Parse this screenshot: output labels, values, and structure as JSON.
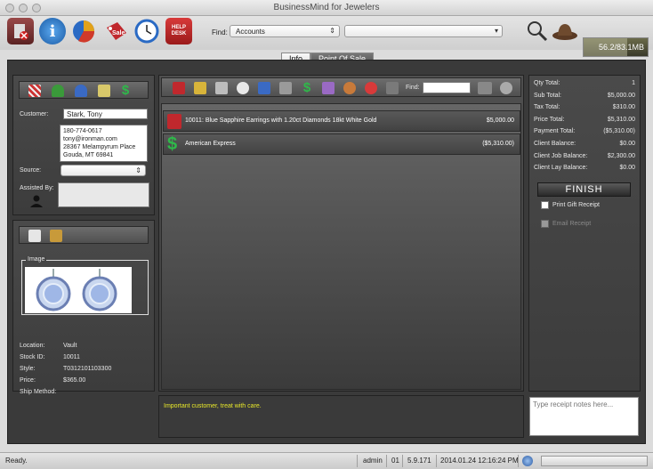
{
  "window": {
    "title": "BusinessMind for Jewelers"
  },
  "toolbar": {
    "buttons": [
      {
        "name": "close-document-icon",
        "color": "#8a3a3a",
        "label": ""
      },
      {
        "name": "info-icon",
        "color": "#1f6fc4",
        "label": ""
      },
      {
        "name": "pie-chart-icon",
        "color": "#d08a20",
        "label": ""
      },
      {
        "name": "sale-tag-icon",
        "color": "#c0282d",
        "label": "Sale"
      },
      {
        "name": "clock-icon",
        "color": "#3a7ac0",
        "label": ""
      },
      {
        "name": "help-desk-icon",
        "color": "#c0282d",
        "label": "HELP DESK"
      }
    ],
    "find_label": "Find:",
    "find_category": "Accounts",
    "find_value": "",
    "search_icon": "magnifier-icon",
    "hat_icon": "detective-hat-icon",
    "memory": "56.2/83.1MB",
    "memory_fraction": 0.68
  },
  "tabs": [
    {
      "label": "Info",
      "selected": false
    },
    {
      "label": "Point Of Sale",
      "selected": true
    }
  ],
  "customer": {
    "customer_label": "Customer:",
    "customer_name": "Stark, Tony",
    "phone": "180-774-0617",
    "email": "tony@ironman.com",
    "address1": "28367 Melampyrum Place",
    "address2": "Gouda, MT 69841",
    "source_label": "Source:",
    "source_value": "",
    "assisted_label": "Assisted By:"
  },
  "item": {
    "image_label": "Image",
    "location_label": "Location:",
    "location": "Vault",
    "stock_label": "Stock ID:",
    "stock": "10011",
    "style_label": "Style:",
    "style": "T0312101103300",
    "price_label": "Price:",
    "price": "$365.00",
    "ship_label": "Ship Method:",
    "ship": ""
  },
  "pos": {
    "find_label": "Find:",
    "lines": [
      {
        "text": "10011: Blue Sapphire Earrings with 1.20ct Diamonds 18kt White Gold",
        "amount": "$5,000.00",
        "icon": "shopping-bag-icon"
      },
      {
        "text": "American Express",
        "amount": "($5,310.00)",
        "icon": "dollar-icon"
      }
    ],
    "note": "Important customer, treat with care."
  },
  "summary": {
    "rows": [
      {
        "label": "Qty Total:",
        "value": "1"
      },
      {
        "label": "Sub Total:",
        "value": "$5,000.00"
      },
      {
        "label": "Tax Total:",
        "value": "$310.00"
      },
      {
        "label": "Price Total:",
        "value": "$5,310.00"
      },
      {
        "label": "Payment Total:",
        "value": "($5,310.00)"
      },
      {
        "label": "Client Balance:",
        "value": "$0.00"
      },
      {
        "label": "Client Job Balance:",
        "value": "$2,300.00"
      },
      {
        "label": "Client Lay Balance:",
        "value": "$0.00"
      }
    ],
    "finish": "FINISH",
    "print_gift": "Print Gift Receipt",
    "email_receipt": "Email Receipt",
    "notes_placeholder": "Type receipt notes here..."
  },
  "status": {
    "text": "Ready.",
    "user": "admin",
    "store": "01",
    "version": "5.9.171",
    "datetime": "2014.01.24 12:16:24 PM"
  }
}
